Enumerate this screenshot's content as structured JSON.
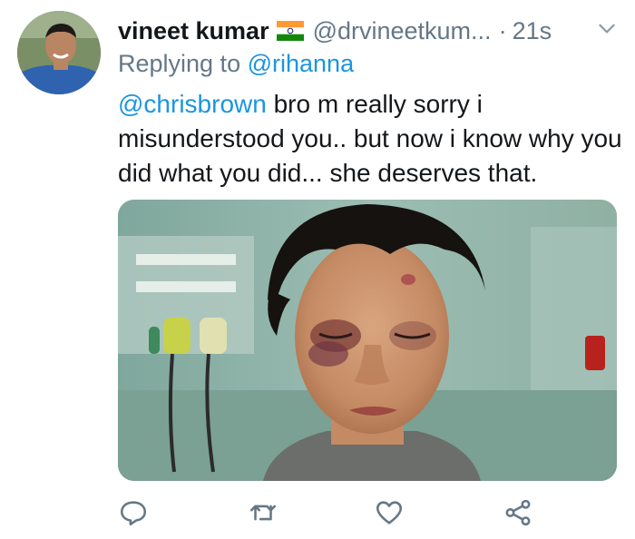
{
  "tweet": {
    "author": {
      "display_name": "vineet kumar",
      "flag_emoji": "india-flag-icon",
      "handle": "@drvineetkum...",
      "timestamp": "21s"
    },
    "separator": "·",
    "replying_prefix": "Replying to",
    "replying_to": "@rihanna",
    "text_mention": "@chrisbrown",
    "text_body": " bro m really sorry i misunderstood you.. but now i know why you did what you did... she deserves that.",
    "media_alt": "photo",
    "actions": [
      "reply-icon",
      "retweet-icon",
      "like-icon",
      "share-icon"
    ]
  },
  "colors": {
    "link": "#1b95e0",
    "secondary": "#657786",
    "text": "#14171a"
  }
}
